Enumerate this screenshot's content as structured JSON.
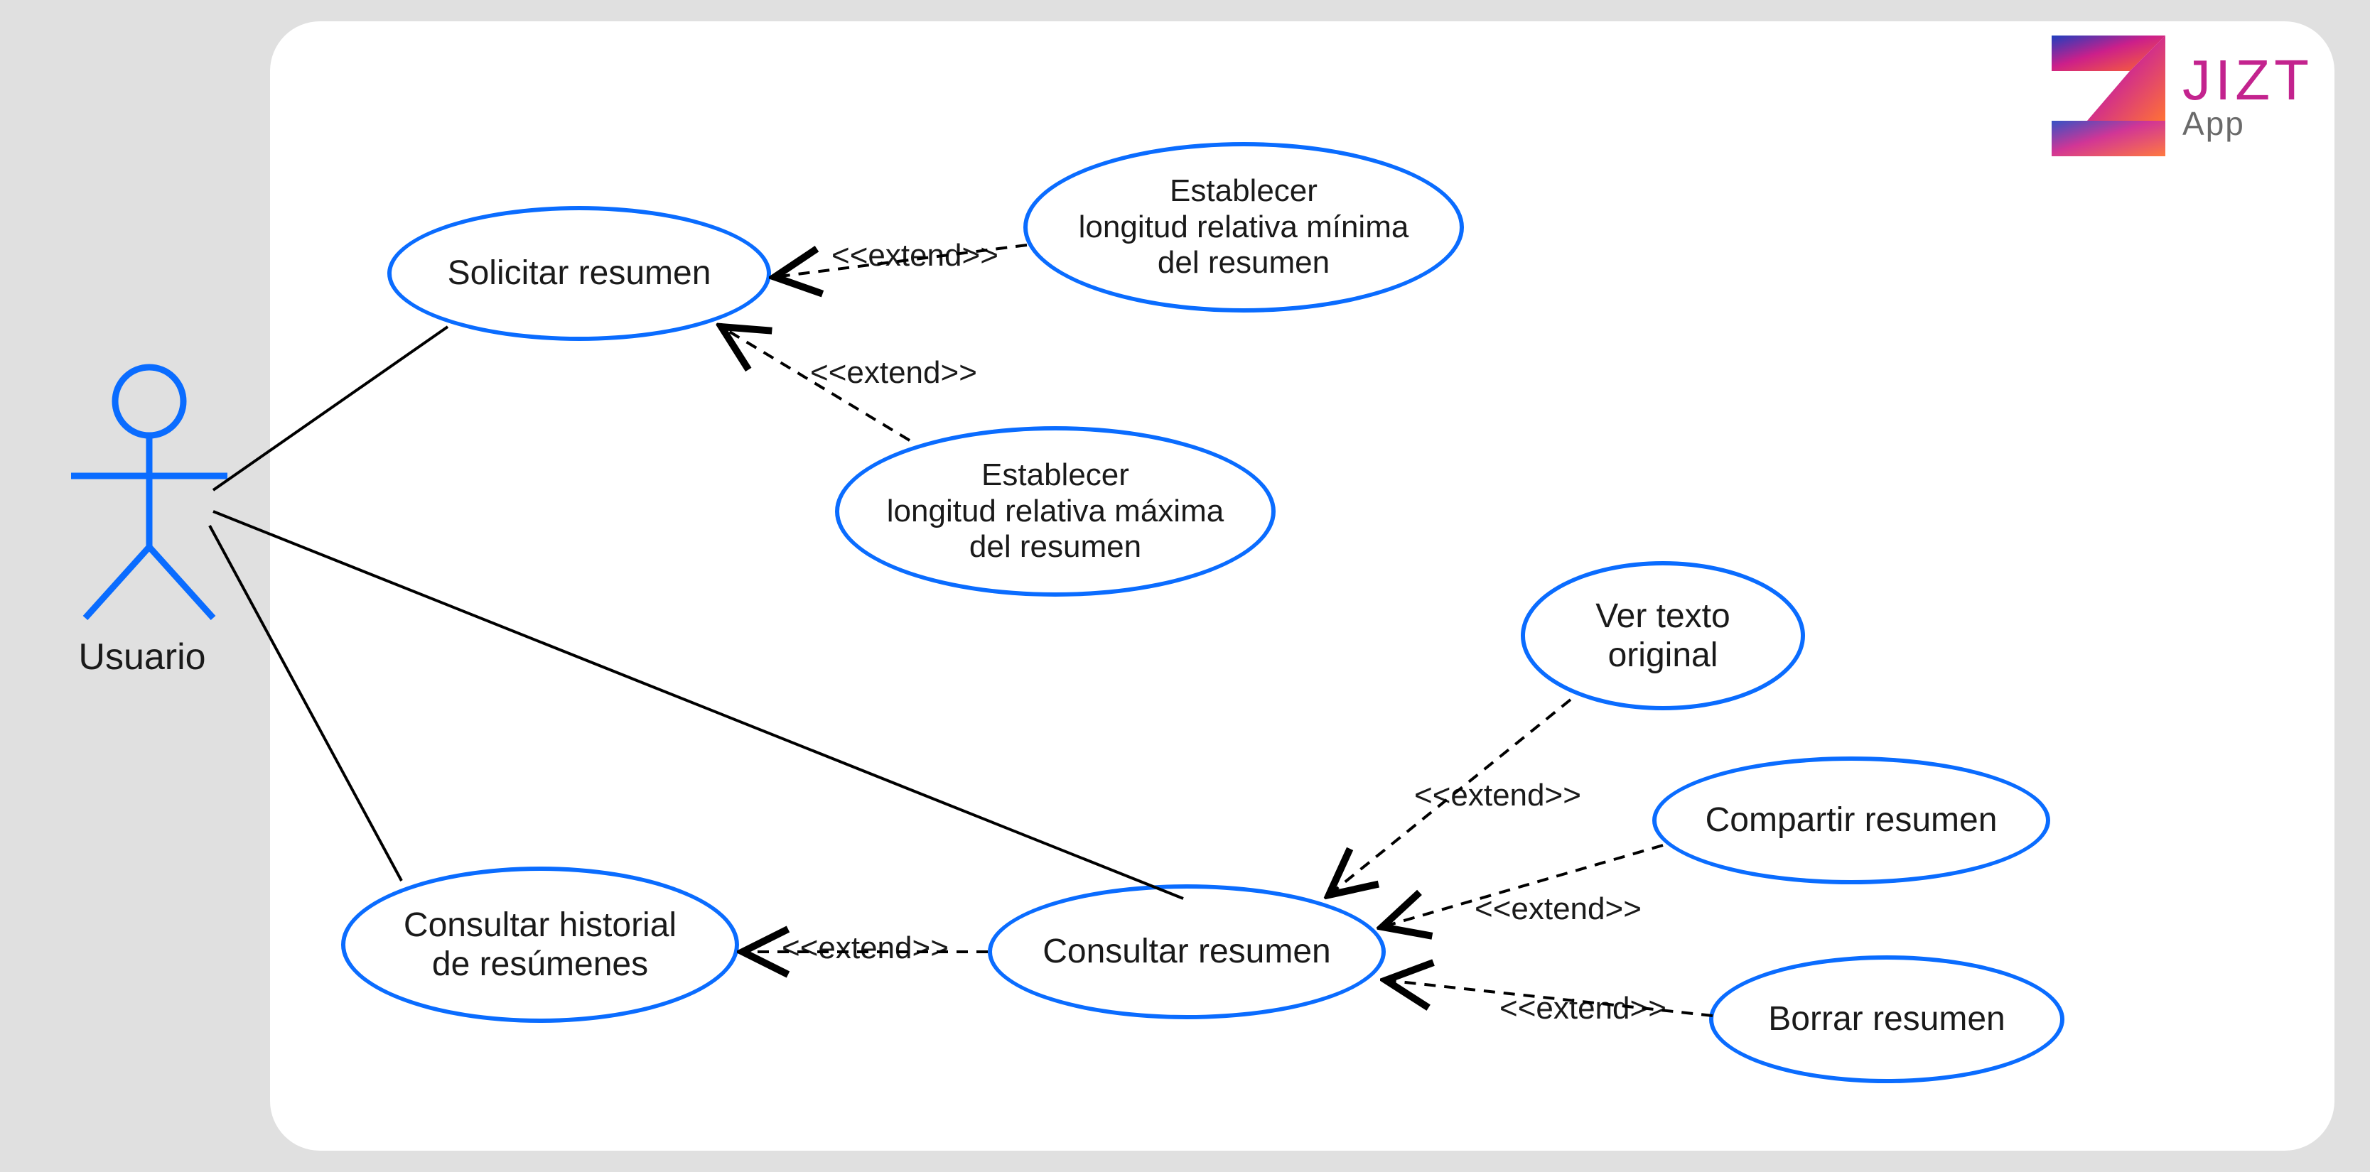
{
  "actor": {
    "label": "Usuario"
  },
  "system": {
    "title": "JIZT",
    "subtitle": "App"
  },
  "usecases": {
    "solicitar": "Solicitar resumen",
    "min_len": "Establecer\nlongitud relativa mínima\ndel resumen",
    "max_len": "Establecer\nlongitud relativa máxima\ndel resumen",
    "historial": "Consultar historial\nde resúmenes",
    "consultar": "Consultar resumen",
    "ver_original": "Ver texto\noriginal",
    "compartir": "Compartir resumen",
    "borrar": "Borrar resumen"
  },
  "relations": {
    "extend": "<<extend>>"
  }
}
